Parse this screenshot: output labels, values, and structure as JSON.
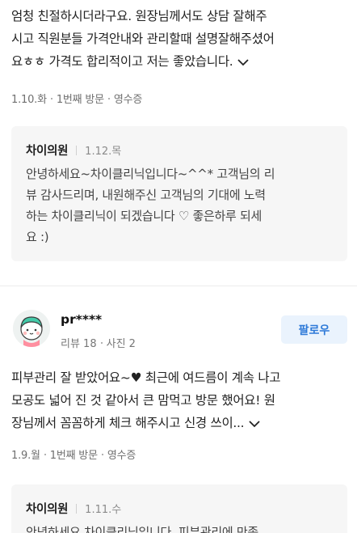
{
  "review1": {
    "lines": [
      "엄청 친절하시더라구요. 원장님께서도 상담 잘해주",
      "시고 직원분들 가격안내와 관리할때 설명잘해주셨어",
      "요ㅎㅎ 가격도 합리적이고 저는 좋았습니다."
    ],
    "meta": {
      "date": "1.10.화",
      "visit": "1번째 방문",
      "receipt": "영수증"
    },
    "reply": {
      "author": "차이의원",
      "date": "1.12.목",
      "lines": [
        "안녕하세요~차이클리닉입니다~^^* 고객님의 리",
        "뷰 감사드리며, 내원해주신 고객님의 기대에 노력",
        "하는 차이클리닉이 되겠습니다 ♡ 좋은하루 되세",
        "요 :)"
      ]
    }
  },
  "review2": {
    "user": {
      "name": "pr****",
      "reviews": "리뷰 18",
      "photos": "사진 2"
    },
    "follow_label": "팔로우",
    "lines": [
      "피부관리 잘 받았어요~♥ 최근에 여드름이 계속 나고",
      "모공도 넓어 진 것 같아서 큰 맘먹고 방문 했어요! 원",
      "장님께서 꼼꼼하게 체크 해주시고 신경 쓰이..."
    ],
    "meta": {
      "date": "1.9.월",
      "visit": "1번째 방문",
      "receipt": "영수증"
    },
    "reply": {
      "author": "차이의원",
      "date": "1.11.수",
      "lines": [
        "안녕하세요 차이클리닉입니다. 피부관리에 만족"
      ]
    }
  }
}
